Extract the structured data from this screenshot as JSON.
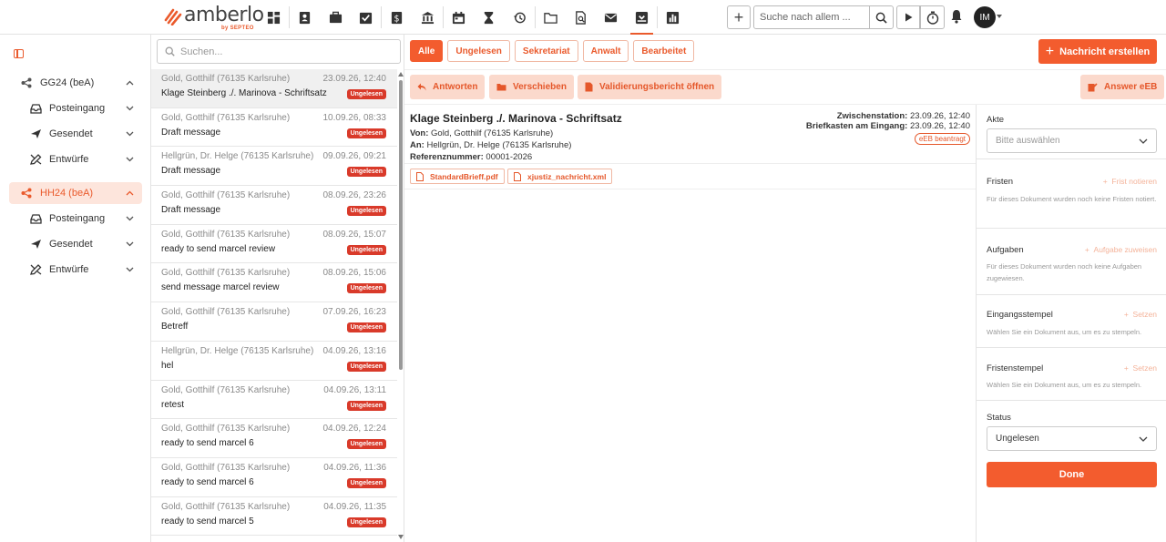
{
  "app": {
    "logo_text": "amberlo",
    "logo_sub": "by SEPTEO",
    "search_placeholder": "Suche nach allem ...",
    "user_initials": "IM"
  },
  "nav_icons": [
    "dashboard-icon",
    "contacts-icon",
    "briefcase-icon",
    "tasks-icon",
    "billing-icon",
    "bank-icon",
    "calendar-icon",
    "hourglass-icon",
    "history-icon",
    "folder-icon",
    "document-search-icon",
    "mail-icon",
    "bea-inbox-icon",
    "reports-icon"
  ],
  "sidebar": {
    "accounts": [
      {
        "label": "GG24 (beA)",
        "selected": false,
        "items": [
          {
            "label": "Posteingang",
            "icon": "inbox-icon"
          },
          {
            "label": "Gesendet",
            "icon": "send-icon"
          },
          {
            "label": "Entwürfe",
            "icon": "drafts-icon"
          }
        ]
      },
      {
        "label": "HH24 (beA)",
        "selected": true,
        "items": [
          {
            "label": "Posteingang",
            "icon": "inbox-icon"
          },
          {
            "label": "Gesendet",
            "icon": "send-icon"
          },
          {
            "label": "Entwürfe",
            "icon": "drafts-icon"
          }
        ]
      }
    ]
  },
  "list": {
    "search_placeholder": "Suchen...",
    "messages": [
      {
        "from": "Gold, Gotthilf (76135 Karlsruhe)",
        "date": "23.09.26, 12:40",
        "subject": "Klage Steinberg ./. Marinova - Schriftsatz",
        "badge": "Ungelesen",
        "selected": true
      },
      {
        "from": "Gold, Gotthilf (76135 Karlsruhe)",
        "date": "10.09.26, 08:33",
        "subject": "Draft message",
        "badge": "Ungelesen",
        "selected": false
      },
      {
        "from": "Hellgrün, Dr. Helge (76135 Karlsruhe)",
        "date": "09.09.26, 09:21",
        "subject": "Draft message",
        "badge": "Ungelesen",
        "selected": false
      },
      {
        "from": "Gold, Gotthilf (76135 Karlsruhe)",
        "date": "08.09.26, 23:26",
        "subject": "Draft message",
        "badge": "Ungelesen",
        "selected": false
      },
      {
        "from": "Gold, Gotthilf (76135 Karlsruhe)",
        "date": "08.09.26, 15:07",
        "subject": "ready to send marcel review",
        "badge": "Ungelesen",
        "selected": false
      },
      {
        "from": "Gold, Gotthilf (76135 Karlsruhe)",
        "date": "08.09.26, 15:06",
        "subject": "send message marcel review",
        "badge": "Ungelesen",
        "selected": false
      },
      {
        "from": "Gold, Gotthilf (76135 Karlsruhe)",
        "date": "07.09.26, 16:23",
        "subject": "Betreff",
        "badge": "Ungelesen",
        "selected": false
      },
      {
        "from": "Hellgrün, Dr. Helge (76135 Karlsruhe)",
        "date": "04.09.26, 13:16",
        "subject": "hel",
        "badge": "Ungelesen",
        "selected": false
      },
      {
        "from": "Gold, Gotthilf (76135 Karlsruhe)",
        "date": "04.09.26, 13:11",
        "subject": "retest",
        "badge": "Ungelesen",
        "selected": false
      },
      {
        "from": "Gold, Gotthilf (76135 Karlsruhe)",
        "date": "04.09.26, 12:24",
        "subject": "ready to send marcel 6",
        "badge": "Ungelesen",
        "selected": false
      },
      {
        "from": "Gold, Gotthilf (76135 Karlsruhe)",
        "date": "04.09.26, 11:36",
        "subject": "ready to send marcel 6",
        "badge": "Ungelesen",
        "selected": false
      },
      {
        "from": "Gold, Gotthilf (76135 Karlsruhe)",
        "date": "04.09.26, 11:35",
        "subject": "ready to send marcel 5",
        "badge": "Ungelesen",
        "selected": false
      }
    ]
  },
  "filters": [
    {
      "label": "Alle",
      "active": true
    },
    {
      "label": "Ungelesen",
      "active": false
    },
    {
      "label": "Sekretariat",
      "active": false
    },
    {
      "label": "Anwalt",
      "active": false
    },
    {
      "label": "Bearbeitet",
      "active": false
    }
  ],
  "new_message_label": "Nachricht erstellen",
  "actions": {
    "reply": "Antworten",
    "move": "Verschieben",
    "validation": "Validierungsbericht öffnen",
    "answer_eeb": "Answer eEB"
  },
  "detail": {
    "title": "Klage Steinberg ./. Marinova - Schriftsatz",
    "from_label": "Von:",
    "from": "Gold, Gotthilf (76135 Karlsruhe)",
    "to_label": "An:",
    "to": "Hellgrün, Dr. Helge (76135 Karlsruhe)",
    "ref_label": "Referenznummer:",
    "ref": "00001-2026",
    "station_label": "Zwischenstation:",
    "station": "23.09.26, 12:40",
    "mailbox_label": "Briefkasten am Eingang:",
    "mailbox": "23.09.26, 12:40",
    "eeb_badge": "eEB beantragt",
    "attachments": [
      "StandardBrieff.pdf",
      "xjustiz_nachricht.xml"
    ]
  },
  "right_panel": {
    "akte_label": "Akte",
    "akte_placeholder": "Bitte auswählen",
    "fristen_label": "Fristen",
    "fristen_link": "Frist notieren",
    "fristen_text": "Für dieses Dokument wurden noch keine Fristen notiert.",
    "aufgaben_label": "Aufgaben",
    "aufgaben_link": "Aufgabe zuweisen",
    "aufgaben_text": "Für dieses Dokument wurden noch keine Aufgaben zugewiesen.",
    "eingang_label": "Eingangsstempel",
    "eingang_link": "Setzen",
    "eingang_text": "Wählen Sie ein Dokument aus, um es zu stempeln.",
    "fristen_stempel_label": "Fristenstempel",
    "fristen_stempel_link": "Setzen",
    "fristen_stempel_text": "Wählen Sie ein Dokument aus, um es zu stempeln.",
    "status_label": "Status",
    "status_value": "Ungelesen",
    "done_label": "Done"
  },
  "colors": {
    "accent": "#f35c2e",
    "accent_light": "#fbd9cc",
    "badge": "#d93a2a"
  }
}
